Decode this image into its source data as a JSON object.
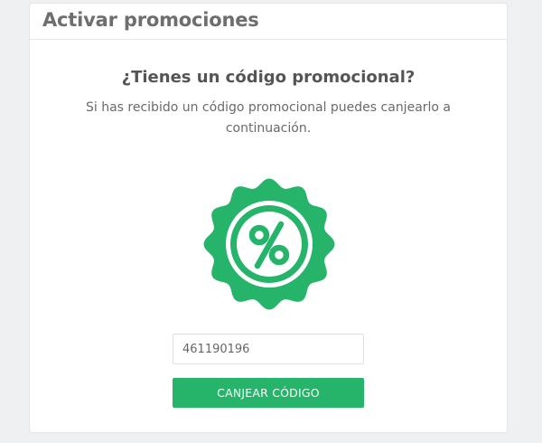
{
  "card": {
    "title": "Activar promociones"
  },
  "promo": {
    "heading": "¿Tienes un código promocional?",
    "description": "Si has recibido un código promocional puedes canjearlo a continuación.",
    "icon": "percent-badge-icon",
    "code_value": "461190196",
    "redeem_label": "CANJEAR CÓDIGO"
  },
  "colors": {
    "accent": "#25b46a",
    "background": "#eef0f2",
    "card": "#ffffff"
  }
}
